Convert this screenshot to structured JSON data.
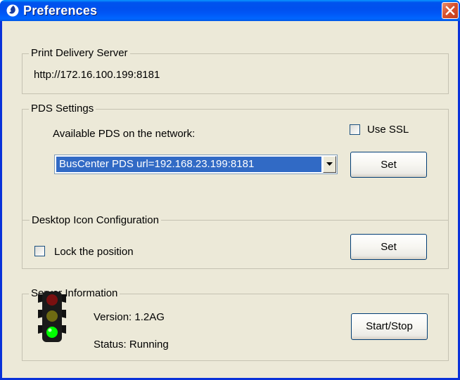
{
  "window": {
    "title": "Preferences",
    "close_icon": "close-icon",
    "app_icon": "pds-app-icon"
  },
  "print_delivery_server": {
    "legend": "Print Delivery Server",
    "url": "http://172.16.100.199:8181"
  },
  "pds_settings": {
    "legend": "PDS Settings",
    "available_label": "Available PDS on the network:",
    "use_ssl_label": "Use SSL",
    "use_ssl_checked": false,
    "selected_pds": "BusCenter PDS url=192.168.23.199:8181",
    "set_label": "Set"
  },
  "desktop_icon": {
    "legend": "Desktop Icon Configuration",
    "lock_label": "Lock the position",
    "lock_checked": false,
    "set_label": "Set"
  },
  "server_info": {
    "legend": "Server Information",
    "version": "Version: 1.2AG",
    "status": "Status: Running",
    "start_stop_label": "Start/Stop",
    "status_icon": "traffic-light-icon",
    "status_color": "#00ff00"
  },
  "colors": {
    "titlebar": "#0053ee",
    "selection": "#316ac5",
    "window_bg": "#ece9d8",
    "close_button": "#d7522f"
  }
}
